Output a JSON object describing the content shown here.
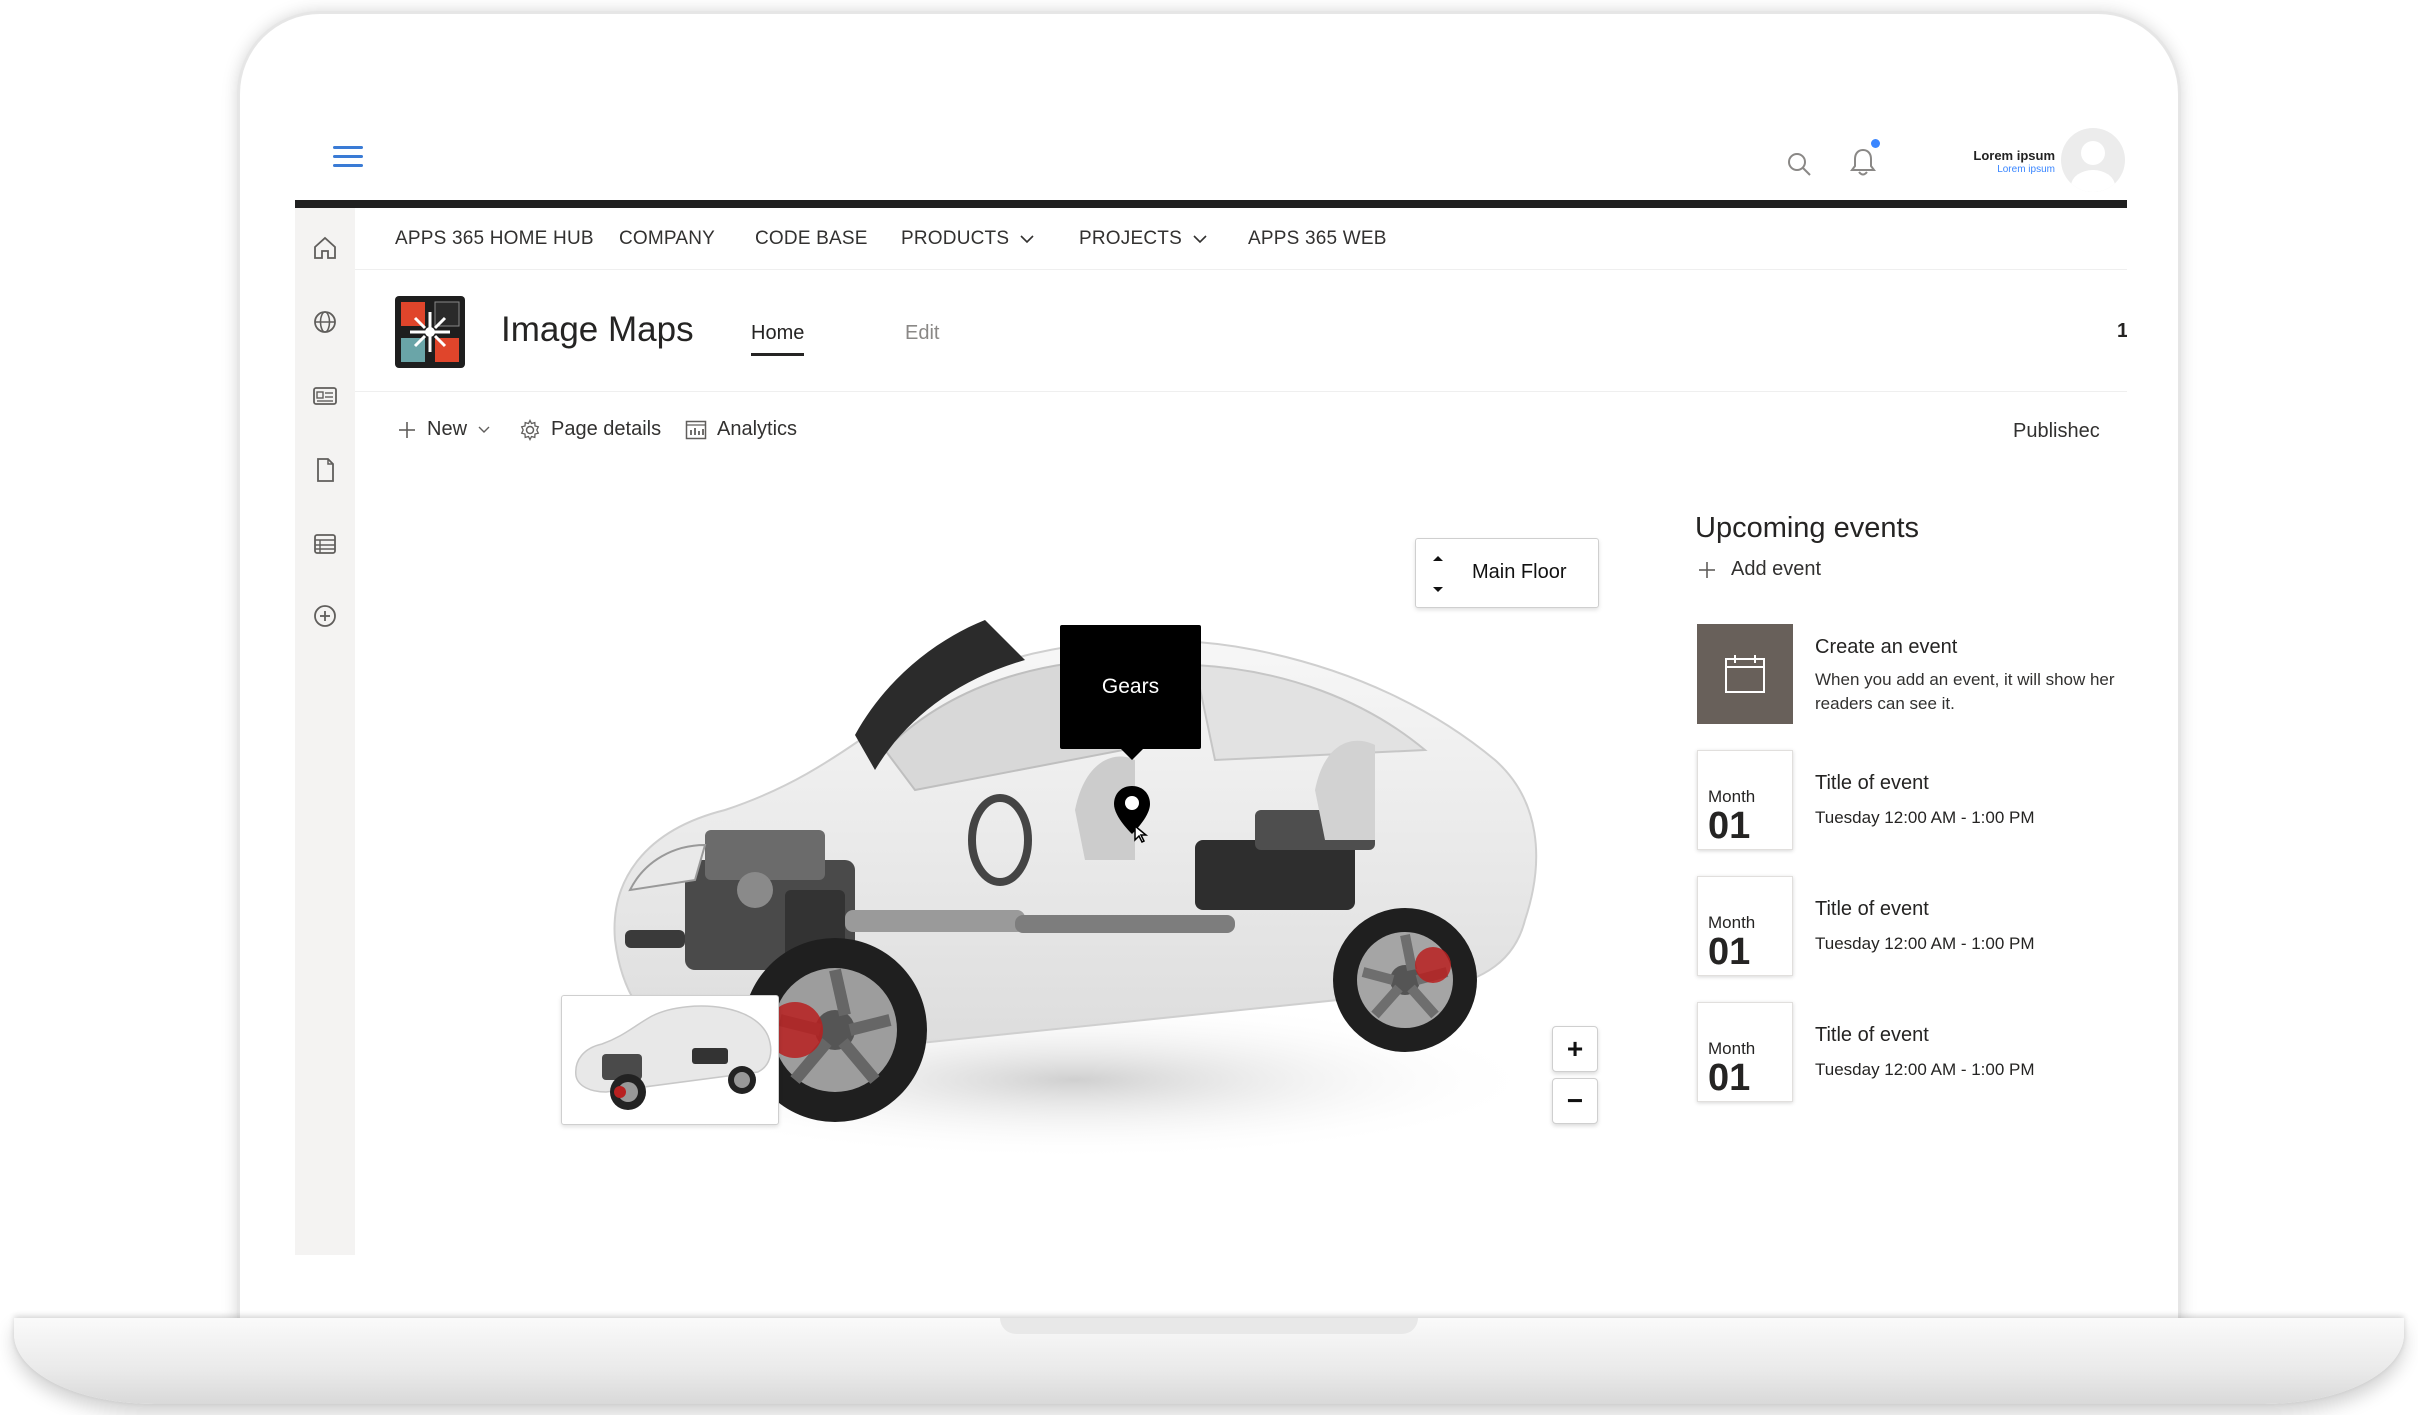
{
  "user": {
    "name": "Lorem ipsum",
    "subtitle": "Lorem ipsum"
  },
  "hub_nav": [
    {
      "label": "APPS 365 HOME HUB",
      "dropdown": false
    },
    {
      "label": "COMPANY",
      "dropdown": false
    },
    {
      "label": "CODE BASE",
      "dropdown": false
    },
    {
      "label": "PRODUCTS",
      "dropdown": true
    },
    {
      "label": "PROJECTS",
      "dropdown": true
    },
    {
      "label": "APPS 365 WEB",
      "dropdown": false
    }
  ],
  "site": {
    "title": "Image Maps",
    "tabs": {
      "home": "Home",
      "edit": "Edit"
    },
    "header_truncated": "1"
  },
  "commands": {
    "new": "New",
    "page_details": "Page details",
    "analytics": "Analytics",
    "status": "Publishec"
  },
  "image_map": {
    "floor": "Main Floor",
    "tooltip": "Gears",
    "zoom_in": "+",
    "zoom_out": "−"
  },
  "events": {
    "title": "Upcoming events",
    "add": "Add event",
    "create_title": "Create an event",
    "create_desc_1": "When you add an event, it will show her",
    "create_desc_2": "readers can see it.",
    "items": [
      {
        "month": "Month",
        "day": "01",
        "title": "Title of event",
        "time": "Tuesday 12:00 AM - 1:00 PM"
      },
      {
        "month": "Month",
        "day": "01",
        "title": "Title of event",
        "time": "Tuesday 12:00 AM - 1:00 PM"
      },
      {
        "month": "Month",
        "day": "01",
        "title": "Title of event",
        "time": "Tuesday 12:00 AM - 1:00 PM"
      }
    ]
  },
  "colors": {
    "accent": "#3a7bd5",
    "notification": "#3a86ff",
    "dark_bar": "#202020",
    "event_tile": "#68605a"
  },
  "icons": [
    "hamburger-icon",
    "search-icon",
    "bell-icon",
    "home-icon",
    "globe-icon",
    "news-icon",
    "document-icon",
    "list-icon",
    "add-circle-icon",
    "plus-icon",
    "gear-icon",
    "analytics-icon",
    "calendar-icon",
    "map-pin-icon"
  ]
}
